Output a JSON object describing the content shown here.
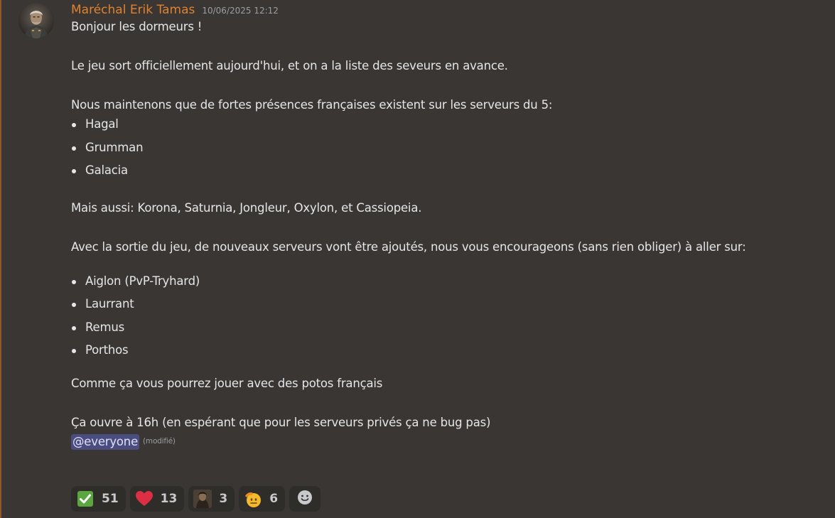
{
  "message": {
    "author": "Maréchal Erik Tamas",
    "timestamp": "10/06/2025 12:12",
    "paragraphs": {
      "greeting": "Bonjour les dormeurs !",
      "release": "Le jeu sort officiellement aujourd'hui, et on a la liste des seveurs en avance.",
      "maintain": "Nous maintenons que de fortes présences françaises existent sur les serveurs du 5:",
      "also": "Mais aussi: Korona, Saturnia, Jongleur, Oxylon, et Cassiopeia.",
      "new_servers": "Avec la sortie du jeu, de nouveaux serveurs vont être ajoutés, nous vous encourageons (sans rien obliger) à aller sur:",
      "friends": "Comme ça vous pourrez jouer avec des potos français",
      "opening": "Ça ouvre à 16h (en espérant que pour les serveurs privés ça ne bug pas)"
    },
    "list_main": [
      "Hagal",
      "Grumman",
      "Galacia"
    ],
    "list_new": [
      "Aiglon (PvP-Tryhard)",
      "Laurrant",
      "Remus",
      "Porthos"
    ],
    "mention": "@everyone",
    "edited": "(modifié)"
  },
  "reactions": [
    {
      "icon": "check-mark-icon",
      "count": "51"
    },
    {
      "icon": "red-heart-icon",
      "count": "13"
    },
    {
      "icon": "custom-soldier-icon",
      "count": "3"
    },
    {
      "icon": "saluting-face-icon",
      "count": "6"
    }
  ],
  "colors": {
    "background": "#393633",
    "author": "#e0822f",
    "mention_bg": "#4a4d7e",
    "accent_border": "#8d5b2e"
  }
}
